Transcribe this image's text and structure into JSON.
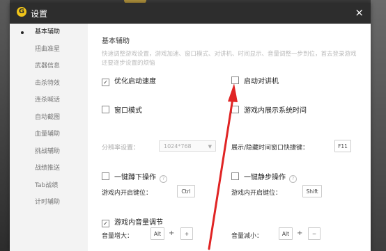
{
  "window": {
    "title": "设置",
    "close_glyph": "×"
  },
  "sidebar": {
    "items": [
      {
        "label": "基本辅助",
        "active": true
      },
      {
        "label": "扭曲准星"
      },
      {
        "label": "武器信息"
      },
      {
        "label": "击杀特效"
      },
      {
        "label": "连杀喊话"
      },
      {
        "label": "自动截图"
      },
      {
        "label": "血量辅助"
      },
      {
        "label": "挑战辅助"
      },
      {
        "label": "战绩推送"
      },
      {
        "label": "Tab战绩"
      },
      {
        "label": "计时辅助"
      }
    ]
  },
  "main": {
    "section_title": "基本辅助",
    "description": "快速调整游戏设置，游戏加速、窗口模式、对讲机、时间显示、音量调整一步到位，首去登录游戏还要逐步设置的烦恼",
    "optimize_speed": {
      "label": "优化启动速度",
      "checked": true
    },
    "walkie_talkie": {
      "label": "启动对讲机",
      "checked": false
    },
    "window_mode": {
      "label": "窗口模式",
      "checked": false
    },
    "resolution_label": "分辨率设置：",
    "resolution_value": "1024*768",
    "show_time": {
      "label": "游戏内展示系统时间",
      "checked": false
    },
    "time_hotkey_label": "展示/隐藏时间窗口快捷键：",
    "time_hotkey": "F11",
    "squat": {
      "label": "一键蹲下操作",
      "checked": false
    },
    "squat_hotkey_label": "游戏内开启键位：",
    "squat_hotkey": "Ctrl",
    "mute": {
      "label": "一键静步操作",
      "checked": false
    },
    "mute_hotkey_label": "游戏内开启键位：",
    "mute_hotkey": "Shift",
    "volume": {
      "label": "游戏内音量调节",
      "checked": true
    },
    "vol_up_label": "音量增大：",
    "vol_up_key1": "Alt",
    "vol_up_key2": "+",
    "vol_down_label": "音量减小：",
    "vol_down_key1": "Alt",
    "vol_down_key2": "−",
    "plus_sign": "+",
    "help_glyph": "?",
    "check_glyph": "✓"
  },
  "colors": {
    "titlebar": "#2d2d2d",
    "arrow": "#e02424",
    "logo": "#f0c419"
  }
}
